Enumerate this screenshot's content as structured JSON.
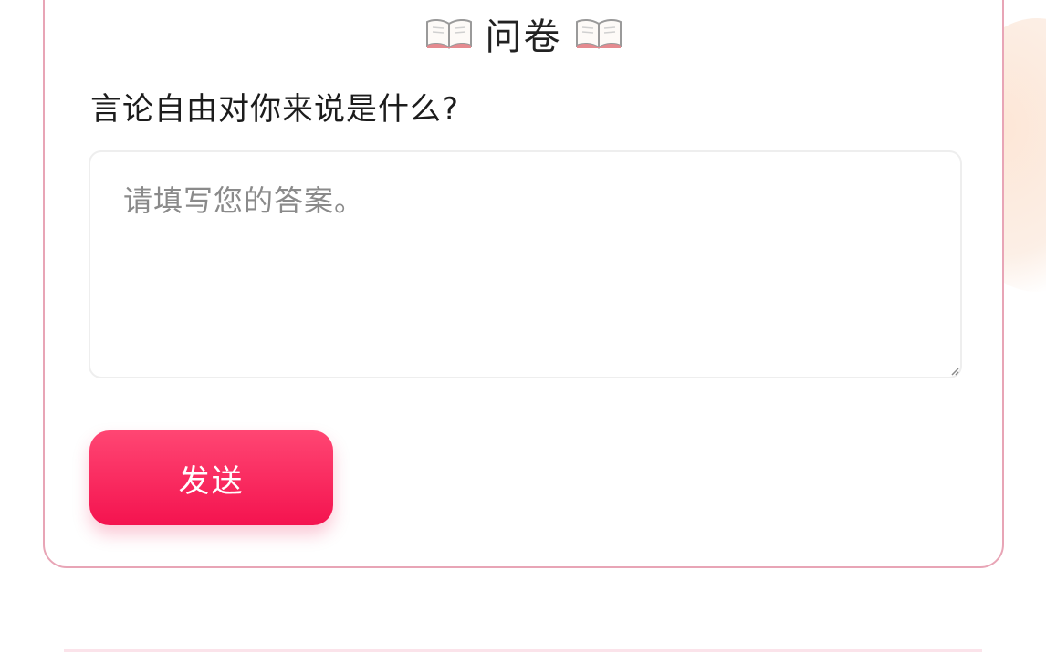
{
  "survey": {
    "title": "问卷",
    "question": "言论自由对你来说是什么?",
    "answer_placeholder": "请填写您的答案。",
    "answer_value": "",
    "send_label": "发送"
  },
  "icons": {
    "title_left": "open-book-icon",
    "title_right": "open-book-icon"
  },
  "colors": {
    "card_border": "#e8a5b6",
    "button_top": "#ff4673",
    "button_bottom": "#f4134f",
    "button_text": "#ffffff",
    "background_blob": "#fde6d6"
  }
}
